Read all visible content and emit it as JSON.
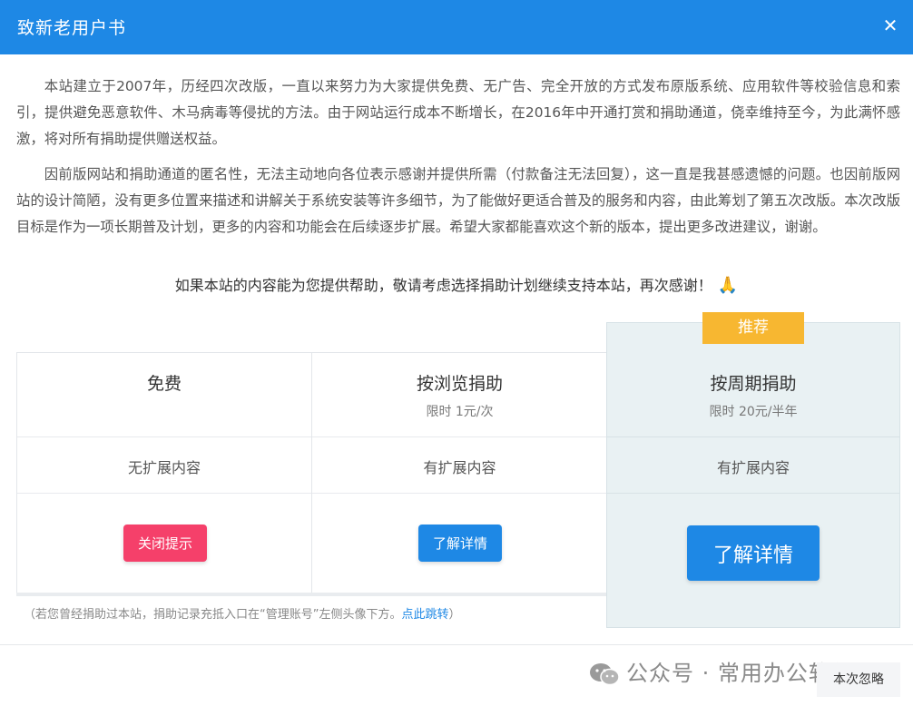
{
  "header": {
    "title": "致新老用户书",
    "close_icon": "close-icon"
  },
  "intro": {
    "p1": "本站建立于2007年，历经四次改版，一直以来努力为大家提供免费、无广告、完全开放的方式发布原版系统、应用软件等校验信息和索引，提供避免恶意软件、木马病毒等侵扰的方法。由于网站运行成本不断增长，在2016年中开通打赏和捐助通道，侥幸维持至今，为此满怀感激，将对所有捐助提供赠送权益。",
    "p2": "因前版网站和捐助通道的匿名性，无法主动地向各位表示感谢并提供所需（付款备注无法回复），这一直是我甚感遗憾的问题。也因前版网站的设计简陋，没有更多位置来描述和讲解关于系统安装等许多细节，为了能做好更适合普及的服务和内容，由此筹划了第五次改版。本次改版目标是作为一项长期普及计划，更多的内容和功能会在后续逐步扩展。希望大家都能喜欢这个新的版本，提出更多改进建议，谢谢。",
    "thanks": "如果本站的内容能为您提供帮助，敬请考虑选择捐助计划继续支持本站，再次感谢！"
  },
  "plans": [
    {
      "name": "免费",
      "price": "",
      "feature": "无扩展内容",
      "button": "关闭提示",
      "button_color": "#f5406a"
    },
    {
      "name": "按浏览捐助",
      "price": "限时 1元/次",
      "feature": "有扩展内容",
      "button": "了解详情",
      "button_color": "#1e88e5"
    },
    {
      "name": "按周期捐助",
      "price": "限时 20元/半年",
      "feature": "有扩展内容",
      "button": "了解详情",
      "button_color": "#1e88e5",
      "badge": "推荐"
    }
  ],
  "note": {
    "text": "（若您曾经捐助过本站，捐助记录充抵入口在“管理账号”左侧头像下方。",
    "link": "点此跳转",
    "tail": "）"
  },
  "footer": {
    "watermark": "公众号 · 常用办公软件",
    "skip": "本次忽略"
  },
  "colors": {
    "primary": "#1e88e5",
    "danger": "#f5406a",
    "badge": "#f7b731",
    "featured_bg": "#e9f1f3"
  }
}
